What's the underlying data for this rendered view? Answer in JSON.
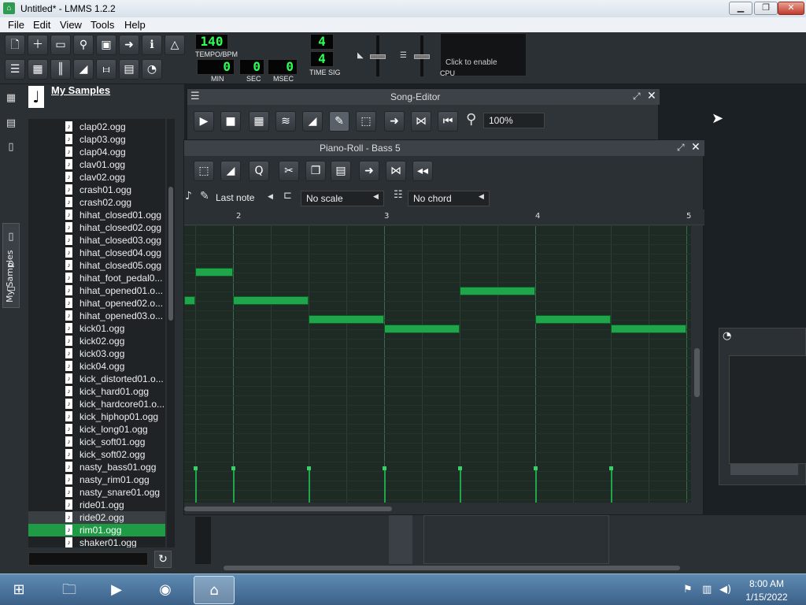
{
  "window": {
    "title": "Untitled* - LMMS 1.2.2",
    "app_icon": "lmms-logo-icon"
  },
  "menu": [
    "File",
    "Edit",
    "View",
    "Tools",
    "Help"
  ],
  "toolbar": {
    "tempo": "140",
    "tempo_label": "TEMPO/BPM",
    "min": "0",
    "sec": "0",
    "msec": "0",
    "min_label": "MIN",
    "sec_label": "SEC",
    "msec_label": "MSEC",
    "timesig_num": "4",
    "timesig_den": "4",
    "timesig_label": "TIME SIG",
    "cpu_hint": "Click to enable",
    "cpu_label": "CPU"
  },
  "side_tab_label": "My Samples",
  "browser": {
    "title": "My Samples",
    "files": [
      "clap02.ogg",
      "clap03.ogg",
      "clap04.ogg",
      "clav01.ogg",
      "clav02.ogg",
      "crash01.ogg",
      "crash02.ogg",
      "hihat_closed01.ogg",
      "hihat_closed02.ogg",
      "hihat_closed03.ogg",
      "hihat_closed04.ogg",
      "hihat_closed05.ogg",
      "hihat_foot_pedal0...",
      "hihat_opened01.o...",
      "hihat_opened02.o...",
      "hihat_opened03.o...",
      "kick01.ogg",
      "kick02.ogg",
      "kick03.ogg",
      "kick04.ogg",
      "kick_distorted01.o...",
      "kick_hard01.ogg",
      "kick_hardcore01.o...",
      "kick_hiphop01.ogg",
      "kick_long01.ogg",
      "kick_soft01.ogg",
      "kick_soft02.ogg",
      "nasty_bass01.ogg",
      "nasty_rim01.ogg",
      "nasty_snare01.ogg",
      "ride01.ogg",
      "ride02.ogg",
      "rim01.ogg",
      "shaker01.ogg"
    ],
    "selected": "rim01.ogg",
    "hover": "ride02.ogg"
  },
  "song_editor": {
    "title": "Song-Editor",
    "zoom": "100%"
  },
  "piano_roll": {
    "title": "Piano-Roll - Bass 5",
    "note_length": "Last note",
    "scale": "No scale",
    "chord": "No chord",
    "bar_numbers": [
      "2",
      "3",
      "4",
      "5"
    ]
  },
  "taskbar": {
    "time": "8:00 AM",
    "date": "1/15/2022"
  },
  "colors": {
    "note": "#1fa64a",
    "lcd_text": "#2bff55",
    "selected_row": "#1f9a45"
  }
}
